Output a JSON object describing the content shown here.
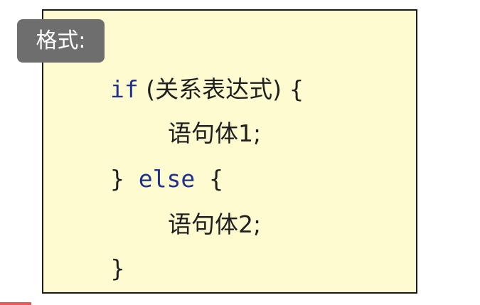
{
  "label": "格式:",
  "code": {
    "line1": {
      "keyword": "if",
      "rest": " (关系表达式) {"
    },
    "line2": {
      "text": "语句体1;"
    },
    "line3": {
      "open": "} ",
      "keyword": "else",
      "close": " {"
    },
    "line4": {
      "text": "语句体2;"
    },
    "line5": {
      "text": "}"
    }
  },
  "colors": {
    "box_background": "#fdfbcf",
    "keyword": "#1d2f8f",
    "label_background": "#6e6e6e"
  }
}
